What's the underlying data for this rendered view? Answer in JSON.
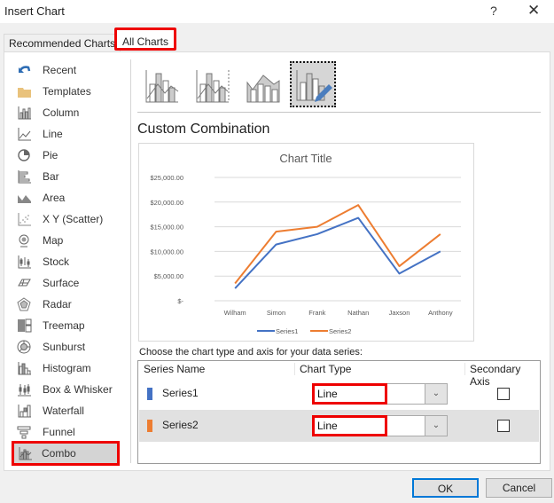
{
  "window": {
    "title": "Insert Chart",
    "help_label": "?",
    "close_label": "✕"
  },
  "tabs": [
    {
      "label": "Recommended Charts",
      "selected": false
    },
    {
      "label": "All Charts",
      "selected": true
    }
  ],
  "sidebar": {
    "items": [
      {
        "label": "Recent",
        "icon": "recent-icon"
      },
      {
        "label": "Templates",
        "icon": "folder-icon"
      },
      {
        "label": "Column",
        "icon": "column-chart-icon"
      },
      {
        "label": "Line",
        "icon": "line-chart-icon"
      },
      {
        "label": "Pie",
        "icon": "pie-chart-icon"
      },
      {
        "label": "Bar",
        "icon": "bar-chart-icon"
      },
      {
        "label": "Area",
        "icon": "area-chart-icon"
      },
      {
        "label": "X Y (Scatter)",
        "icon": "scatter-chart-icon"
      },
      {
        "label": "Map",
        "icon": "map-chart-icon"
      },
      {
        "label": "Stock",
        "icon": "stock-chart-icon"
      },
      {
        "label": "Surface",
        "icon": "surface-chart-icon"
      },
      {
        "label": "Radar",
        "icon": "radar-chart-icon"
      },
      {
        "label": "Treemap",
        "icon": "treemap-chart-icon"
      },
      {
        "label": "Sunburst",
        "icon": "sunburst-chart-icon"
      },
      {
        "label": "Histogram",
        "icon": "histogram-chart-icon"
      },
      {
        "label": "Box & Whisker",
        "icon": "box-whisker-chart-icon"
      },
      {
        "label": "Waterfall",
        "icon": "waterfall-chart-icon"
      },
      {
        "label": "Funnel",
        "icon": "funnel-chart-icon"
      },
      {
        "label": "Combo",
        "icon": "combo-chart-icon",
        "selected": true
      }
    ]
  },
  "subtypes": [
    {
      "name": "clustered-column-line",
      "selected": false
    },
    {
      "name": "clustered-column-line-secondary-axis",
      "selected": false
    },
    {
      "name": "stacked-area-clustered-column",
      "selected": false
    },
    {
      "name": "custom-combination",
      "selected": true
    }
  ],
  "section_title": "Custom Combination",
  "chart_data": {
    "type": "line",
    "title": "Chart Title",
    "xlabel": "",
    "ylabel": "",
    "categories": [
      "Wilham",
      "Simon",
      "Frank",
      "Nathan",
      "Jaxson",
      "Anthony"
    ],
    "series": [
      {
        "name": "Series1",
        "color": "#4472c4",
        "values": [
          2500,
          11400,
          13500,
          16800,
          5500,
          10000
        ]
      },
      {
        "name": "Series2",
        "color": "#ed7d31",
        "values": [
          3500,
          14000,
          15000,
          19400,
          7000,
          13500
        ]
      }
    ],
    "ylim": [
      0,
      25000
    ],
    "yticks": [
      0,
      5000,
      10000,
      15000,
      20000,
      25000
    ],
    "ytick_labels": [
      "$-",
      "$5,000.00",
      "$10,000.00",
      "$15,000.00",
      "$20,000.00",
      "$25,000.00"
    ],
    "grid": true,
    "legend": "bottom"
  },
  "series_config": {
    "prompt": "Choose the chart type and axis for your data series:",
    "headers": {
      "name": "Series Name",
      "type": "Chart Type",
      "axis": "Secondary Axis"
    },
    "rows": [
      {
        "name": "Series1",
        "color": "#4472c4",
        "chart_type": "Line",
        "secondary_axis": false
      },
      {
        "name": "Series2",
        "color": "#ed7d31",
        "chart_type": "Line",
        "secondary_axis": false
      }
    ]
  },
  "buttons": {
    "ok": "OK",
    "cancel": "Cancel"
  },
  "colors": {
    "highlight": "#e00000",
    "accent": "#0078d7",
    "series1": "#4472c4",
    "series2": "#ed7d31"
  }
}
